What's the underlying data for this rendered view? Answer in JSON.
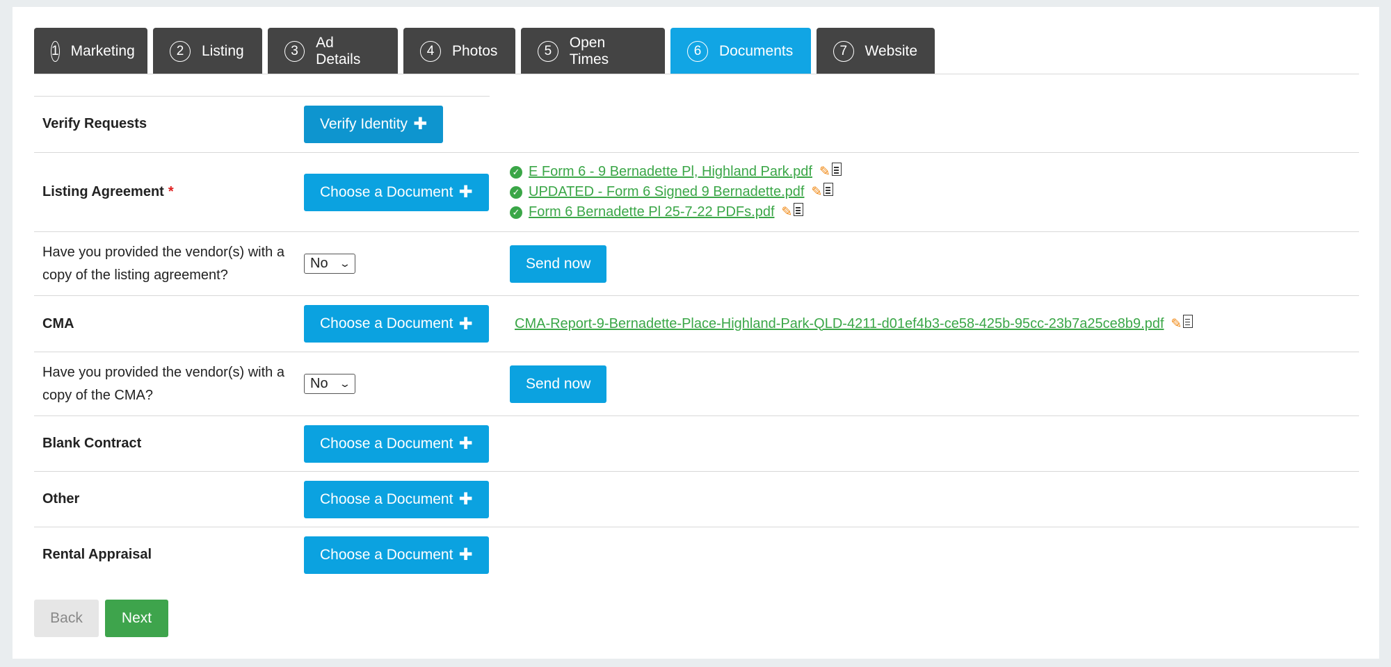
{
  "tabs": [
    {
      "num": "1",
      "label": "Marketing"
    },
    {
      "num": "2",
      "label": "Listing"
    },
    {
      "num": "3",
      "label": "Ad Details"
    },
    {
      "num": "4",
      "label": "Photos"
    },
    {
      "num": "5",
      "label": "Open Times"
    },
    {
      "num": "6",
      "label": "Documents",
      "active": true
    },
    {
      "num": "7",
      "label": "Website"
    }
  ],
  "rows": {
    "verify": {
      "label": "Verify Requests",
      "button": "Verify Identity"
    },
    "listing": {
      "label": "Listing Agreement",
      "required_mark": "*",
      "button": "Choose a Document",
      "files": [
        "E Form 6 - 9 Bernadette Pl, Highland Park.pdf",
        "UPDATED - Form 6 Signed 9 Bernadette.pdf",
        "Form 6 Bernadette Pl 25-7-22 PDFs.pdf"
      ]
    },
    "listing_copy": {
      "label": "Have you provided the vendor(s) with a copy of the listing agreement?",
      "select_value": "No",
      "send_label": "Send now"
    },
    "cma": {
      "label": "CMA",
      "button": "Choose a Document",
      "file": "CMA-Report-9-Bernadette-Place-Highland-Park-QLD-4211-d01ef4b3-ce58-425b-95cc-23b7a25ce8b9.pdf"
    },
    "cma_copy": {
      "label": "Have you provided the vendor(s) with a copy of the CMA?",
      "select_value": "No",
      "send_label": "Send now"
    },
    "blank": {
      "label": "Blank Contract",
      "button": "Choose a Document"
    },
    "other": {
      "label": "Other",
      "button": "Choose a Document"
    },
    "rental": {
      "label": "Rental Appraisal",
      "button": "Choose a Document"
    }
  },
  "footer": {
    "back_label": "Back",
    "next_label": "Next"
  },
  "colors": {
    "accent": "#0ba2e0",
    "tab_dark": "#444444",
    "success": "#3aa647",
    "required": "#e02020"
  },
  "icons": {
    "plus": "plus-icon",
    "check": "check-circle-icon",
    "edit": "pencil-icon",
    "doc": "document-icon",
    "select": "chevron-down-icon"
  }
}
